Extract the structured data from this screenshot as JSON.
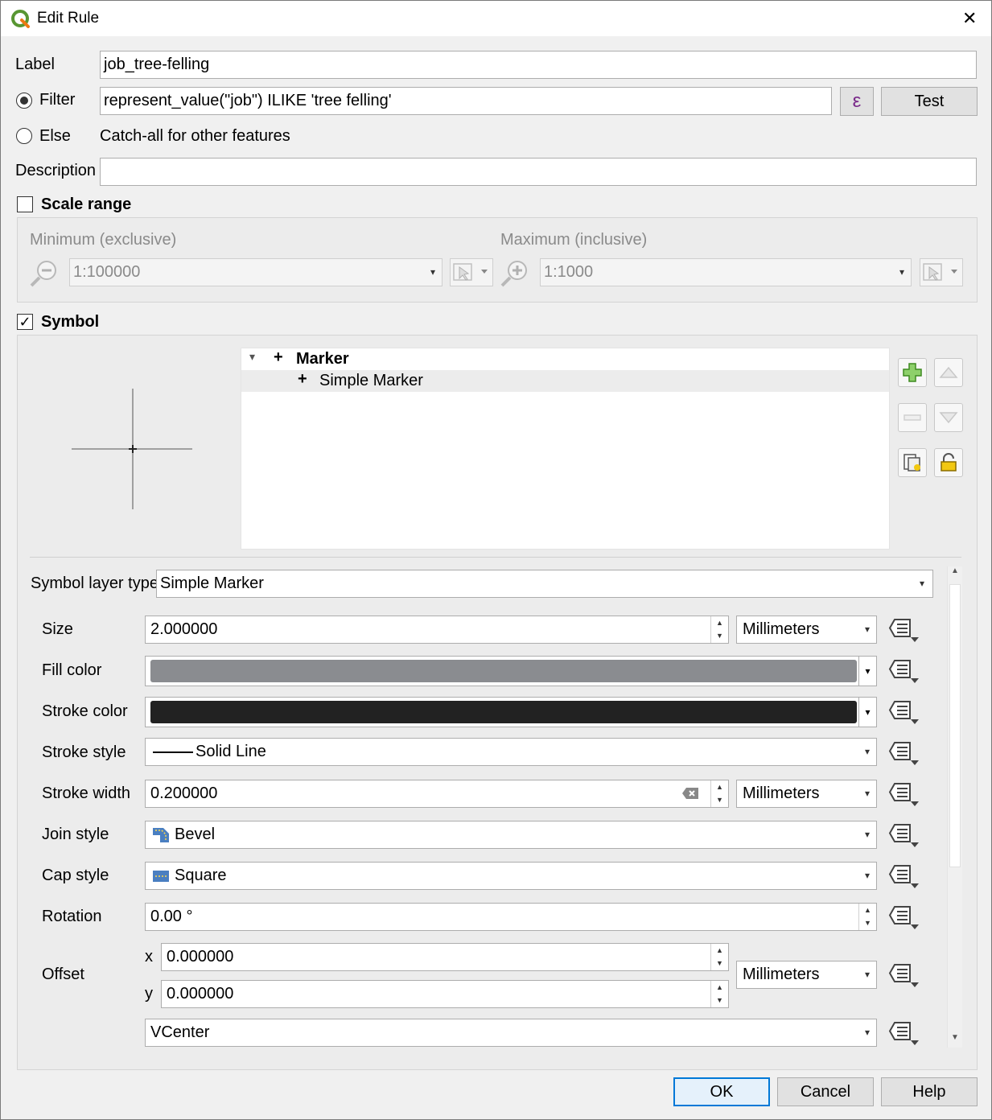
{
  "window": {
    "title": "Edit Rule",
    "close_glyph": "✕"
  },
  "rule": {
    "label_label": "Label",
    "label_value": "job_tree-felling",
    "filter_label": "Filter",
    "filter_value": "represent_value(\"job\") ILIKE 'tree felling'",
    "expression_button": "ε",
    "test_button": "Test",
    "else_label": "Else",
    "else_text": "Catch-all for other features",
    "description_label": "Description",
    "description_value": ""
  },
  "scale_range": {
    "label": "Scale range",
    "checked": false,
    "minimum_label": "Minimum (exclusive)",
    "minimum_value": "1:100000",
    "maximum_label": "Maximum (inclusive)",
    "maximum_value": "1:1000"
  },
  "symbol": {
    "label": "Symbol",
    "checked": true,
    "check_glyph": "✓",
    "tree": {
      "root": "Marker",
      "child": "Simple Marker"
    },
    "layer_type_label": "Symbol layer type",
    "layer_type_value": "Simple Marker",
    "properties": {
      "size_label": "Size",
      "size_value": "2.000000",
      "size_unit": "Millimeters",
      "fill_color_label": "Fill color",
      "fill_color": "#8a8c90",
      "stroke_color_label": "Stroke color",
      "stroke_color": "#222222",
      "stroke_style_label": "Stroke style",
      "stroke_style_value": "Solid Line",
      "stroke_width_label": "Stroke width",
      "stroke_width_value": "0.200000",
      "stroke_width_unit": "Millimeters",
      "join_style_label": "Join style",
      "join_style_value": "Bevel",
      "cap_style_label": "Cap style",
      "cap_style_value": "Square",
      "rotation_label": "Rotation",
      "rotation_value": "0.00 °",
      "offset_label": "Offset",
      "offset_x_label": "x",
      "offset_x_value": "0.000000",
      "offset_y_label": "y",
      "offset_y_value": "0.000000",
      "offset_unit": "Millimeters",
      "anchor_value": "VCenter"
    }
  },
  "buttons": {
    "ok": "OK",
    "cancel": "Cancel",
    "help": "Help"
  },
  "icons": {
    "combo_arrow": "▾",
    "spin_up": "▲",
    "spin_down": "▼",
    "tree_expand": "▾",
    "tree_plus": "+"
  }
}
